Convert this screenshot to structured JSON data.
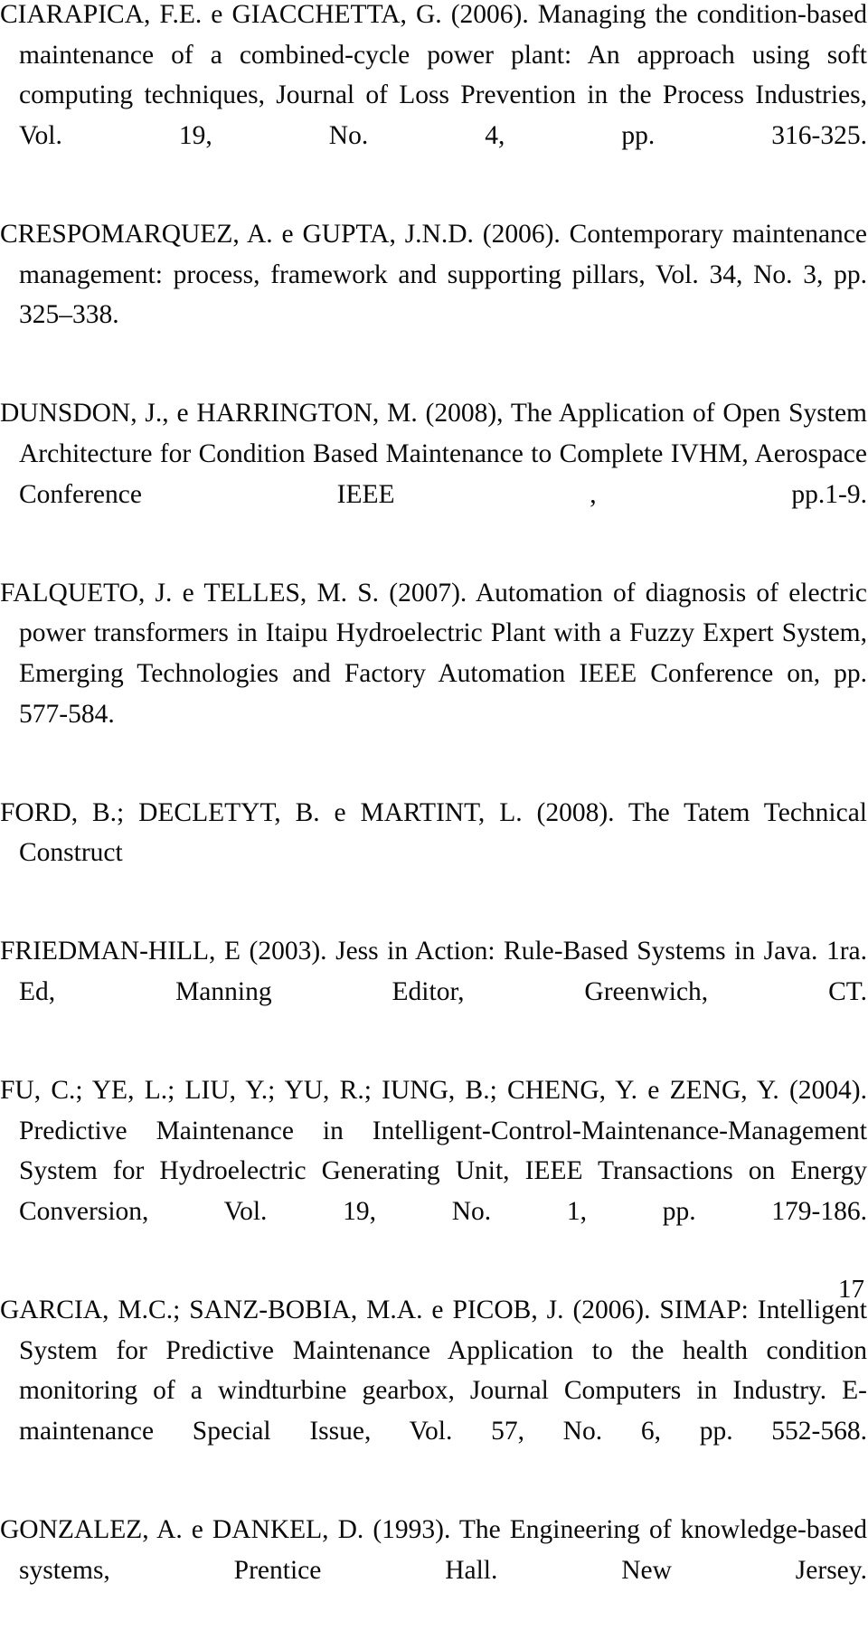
{
  "document": {
    "section": "references",
    "page_number": "17",
    "text_color": "#0a0a0a",
    "background_color": "#ffffff"
  },
  "references": [
    {
      "id": "ciarapica-2006",
      "text": "CIARAPICA, F.E. e GIACCHETTA, G. (2006). Managing the condition-based maintenance of a combined-cycle power plant: An approach using soft computing techniques, Journal of Loss Prevention in the Process Industries, Vol. 19, No. 4, pp. 316-325."
    },
    {
      "id": "crespomarquez-2006",
      "text": "CRESPOMARQUEZ, A. e GUPTA, J.N.D. (2006). Contemporary maintenance management: process, framework and supporting pillars, Vol. 34, No. 3, pp. 325–338."
    },
    {
      "id": "dunsdon-2008",
      "text": "DUNSDON, J., e HARRINGTON, M. (2008), The Application of Open System Architecture for Condition Based Maintenance to Complete IVHM, Aerospace Conference IEEE , pp.1-9."
    },
    {
      "id": "falqueto-2007",
      "text": "FALQUETO, J. e TELLES, M. S. (2007). Automation of diagnosis of electric power transformers in Itaipu Hydroelectric Plant with a Fuzzy Expert System, Emerging Technologies and Factory Automation IEEE Conference on, pp. 577-584."
    },
    {
      "id": "ford-2008",
      "text": "FORD, B.; DECLETYT, B. e MARTINT, L. (2008). The Tatem Technical Construct"
    },
    {
      "id": "friedman-hill-2003",
      "text": "FRIEDMAN-HILL, E (2003). Jess in Action: Rule-Based Systems in Java. 1ra. Ed, Manning Editor, Greenwich, CT."
    },
    {
      "id": "fu-2004",
      "text": "FU, C.; YE, L.; LIU, Y.; YU, R.; IUNG, B.; CHENG, Y. e ZENG, Y. (2004). Predictive Maintenance in Intelligent-Control-Maintenance-Management System for Hydroelectric Generating Unit, IEEE Transactions on Energy Conversion, Vol. 19, No. 1, pp. 179-186."
    },
    {
      "id": "garcia-2006",
      "text": "GARCIA, M.C.; SANZ-BOBIA, M.A. e PICOB, J. (2006). SIMAP: Intelligent System for Predictive Maintenance Application to the health condition monitoring of a windturbine gearbox, Journal Computers in Industry. E-maintenance Special Issue, Vol. 57, No. 6, pp. 552-568."
    },
    {
      "id": "gonzalez-1993",
      "text": "GONZALEZ, A. e DANKEL, D. (1993). The Engineering of knowledge-based systems, Prentice Hall. New Jersey."
    }
  ]
}
